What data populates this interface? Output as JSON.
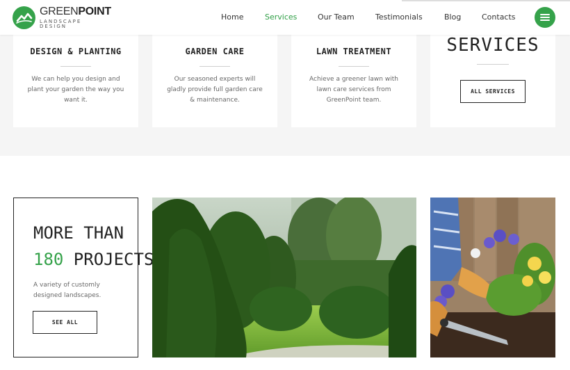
{
  "brand": {
    "name_light": "GREEN",
    "name_bold": "POINT",
    "tagline": "LANDSCAPE DESIGN",
    "accent_color": "#35a24a"
  },
  "nav": {
    "items": [
      {
        "label": "Home",
        "active": false
      },
      {
        "label": "Services",
        "active": true
      },
      {
        "label": "Our Team",
        "active": false
      },
      {
        "label": "Testimonials",
        "active": false
      },
      {
        "label": "Blog",
        "active": false
      },
      {
        "label": "Contacts",
        "active": false
      }
    ],
    "menu_icon": "hamburger-menu-icon"
  },
  "services": {
    "cards": [
      {
        "title": "DESIGN & PLANTING",
        "text": "We can help you design and plant your garden the way you want it."
      },
      {
        "title": "GARDEN CARE",
        "text": "Our seasoned experts will gladly provide full garden care & maintenance."
      },
      {
        "title": "LAWN TREATMENT",
        "text": "Achieve a greener lawn with lawn care services from GreenPoint team."
      }
    ],
    "heading": "SERVICES",
    "all_button": "ALL SERVICES"
  },
  "projects": {
    "line1": "MORE THAN",
    "count": "180",
    "line2_rest": " PROJECTS",
    "description": "A variety of customly designed landscapes.",
    "button": "SEE ALL"
  }
}
